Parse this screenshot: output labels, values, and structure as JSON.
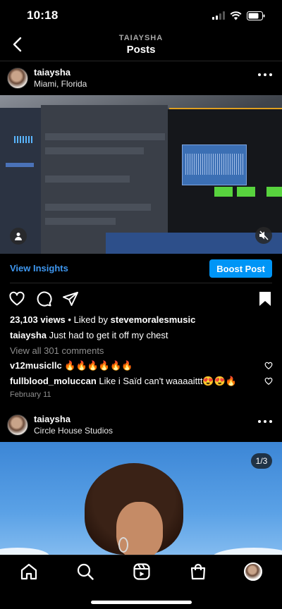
{
  "status_bar": {
    "time": "10:18"
  },
  "header": {
    "username": "TAIAYSHA",
    "title": "Posts"
  },
  "posts": [
    {
      "username": "taiaysha",
      "location": "Miami, Florida",
      "view_insights": "View Insights",
      "boost_label": "Boost Post",
      "views": "23,103 views",
      "liked_by_prefix": "Liked by",
      "liked_by_user": "stevemoralesmusic",
      "caption_user": "taiaysha",
      "caption_text": "Just had to get it off my chest",
      "view_comments": "View all 301 comments",
      "comments": [
        {
          "user": "v12musicllc",
          "text": "🔥🔥🔥🔥🔥🔥"
        },
        {
          "user": "fullblood_moluccan",
          "text": "Like i Saïd can't waaaaittt😍😍🔥"
        }
      ],
      "date": "February 11"
    },
    {
      "username": "taiaysha",
      "location": "Circle House Studios",
      "carousel_counter": "1/3"
    }
  ],
  "icons": {
    "back": "chevron-left-icon",
    "more": "more-horizontal-icon",
    "like": "heart-icon",
    "comment": "comment-icon",
    "share": "send-icon",
    "save": "bookmark-icon",
    "mute": "muted-speaker-icon",
    "tag": "user-tag-icon"
  },
  "colors": {
    "accent": "#0095f6",
    "link": "#3e97f0",
    "secondary_text": "#8e8e8e"
  }
}
